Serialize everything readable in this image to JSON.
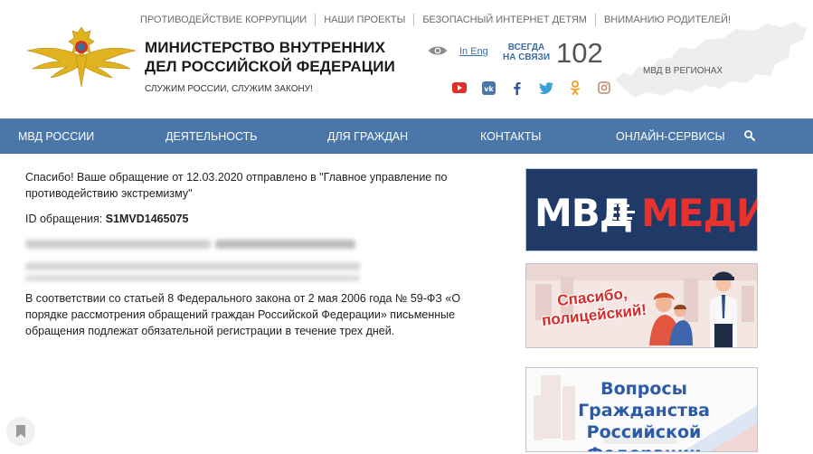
{
  "top_links": [
    "ПРОТИВОДЕЙСТВИЕ КОРРУПЦИИ",
    "НАШИ ПРОЕКТЫ",
    "БЕЗОПАСНЫЙ ИНТЕРНЕТ ДЕТЯМ",
    "ВНИМАНИЮ РОДИТЕЛЕЙ!"
  ],
  "brand": {
    "title": "МИНИСТЕРСТВО ВНУТРЕННИХ ДЕЛ РОССИЙСКОЙ ФЕДЕРАЦИИ",
    "motto": "СЛУЖИМ РОССИИ, СЛУЖИМ ЗАКОНУ!"
  },
  "header": {
    "lang_link": "In Eng",
    "always_label": "ВСЕГДА НА СВЯЗИ",
    "hotline": "102",
    "map_label": "МВД В РЕГИОНАХ"
  },
  "socials": [
    "youtube-icon",
    "vk-icon",
    "facebook-icon",
    "twitter-icon",
    "odnoklassniki-icon",
    "instagram-icon"
  ],
  "colors": {
    "nav_bg": "#4b77a8",
    "accent": "#3a6ea5",
    "media_red": "#e8322f"
  },
  "nav": [
    "МВД РОССИИ",
    "ДЕЯТЕЛЬНОСТЬ",
    "ДЛЯ ГРАЖДАН",
    "КОНТАКТЫ",
    "ОНЛАЙН-СЕРВИСЫ"
  ],
  "content": {
    "confirmation": "Спасибо! Ваше обращение от 12.03.2020 отправлено в \"Главное управление по противодействию экстремизму\"",
    "id_label": "ID обращения:",
    "id_value": "S1MVD1465075",
    "legal_text": "В соответствии со статьей 8 Федерального закона от 2 мая 2006 года № 59-ФЗ «О порядке рассмотрения обращений граждан Российской Федерации» письменные обращения подлежат обязательной регистрации в течение трех дней."
  },
  "banners": {
    "media_left": "МВД",
    "media_right": "МЕДИА",
    "thanks": "Спасибо, полицейский!",
    "citizenship": "Вопросы Гражданства Российской Федерации"
  }
}
